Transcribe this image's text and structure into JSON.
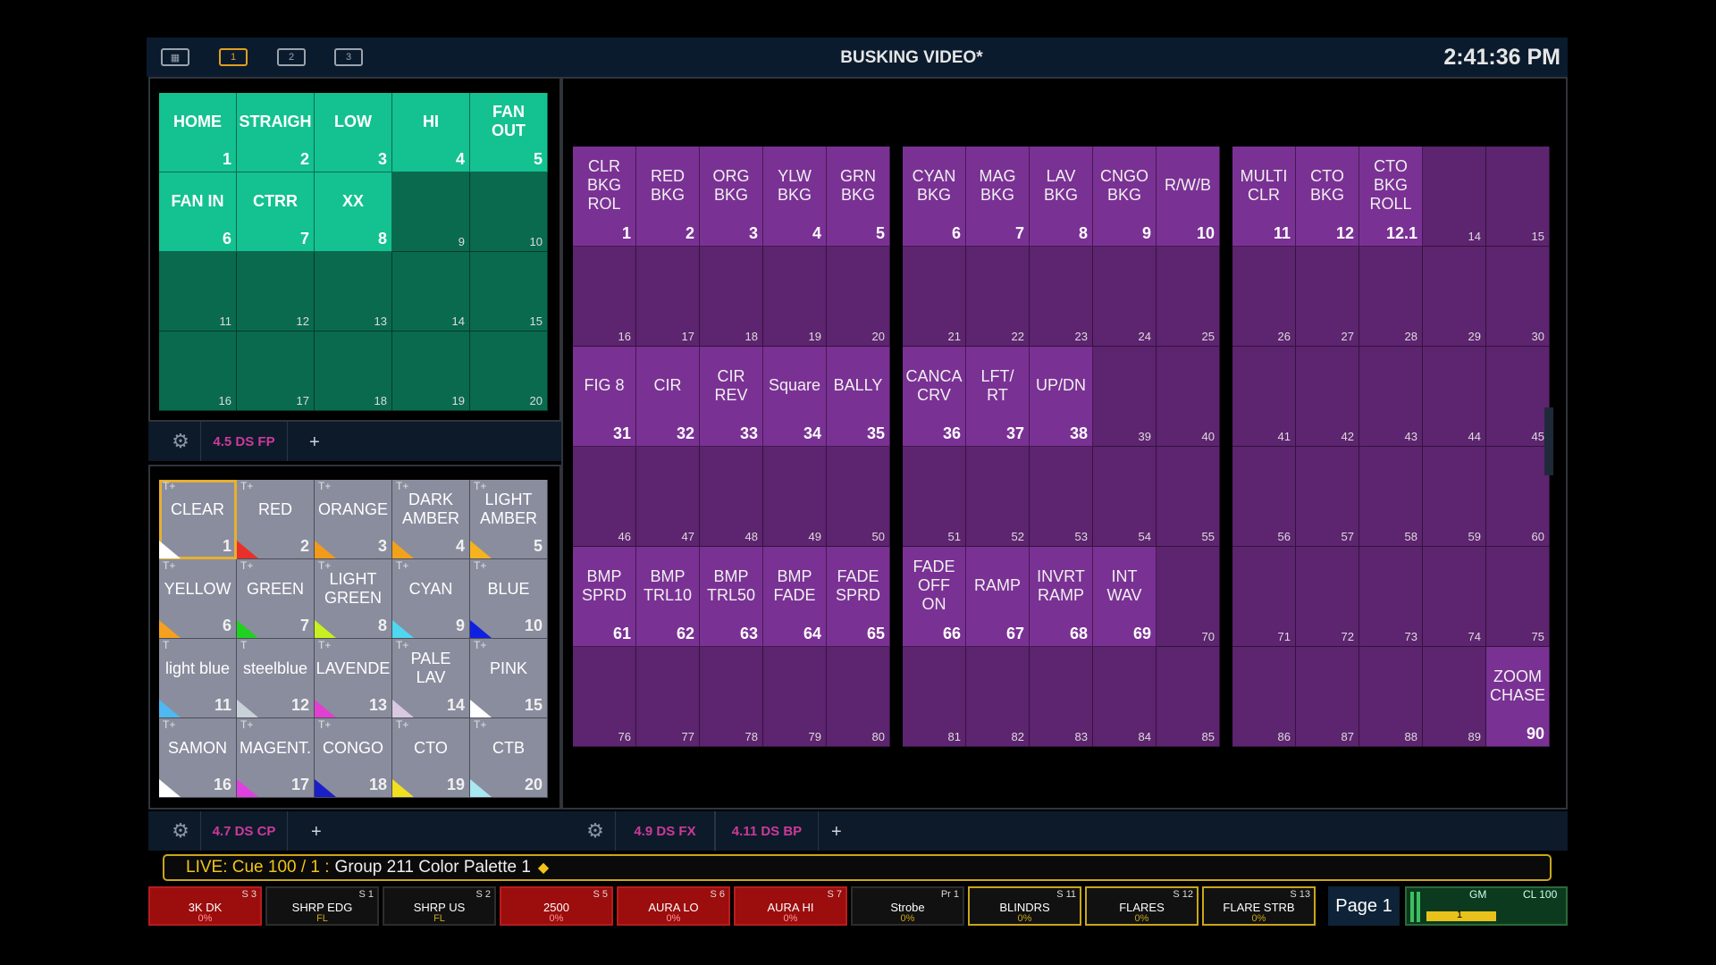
{
  "topbar": {
    "title": "BUSKING VIDEO*",
    "clock": "2:41:36 PM",
    "workspace_tabs": [
      "1",
      "2",
      "3"
    ],
    "active_workspace": "1"
  },
  "focus_palettes": {
    "tab_label": "4.5 DS FP",
    "tiles": [
      {
        "label": "HOME",
        "num": "1"
      },
      {
        "label": "STRAIGH",
        "num": "2"
      },
      {
        "label": "LOW",
        "num": "3"
      },
      {
        "label": "HI",
        "num": "4"
      },
      {
        "label": "FAN\nOUT",
        "num": "5"
      },
      {
        "label": "FAN IN",
        "num": "6"
      },
      {
        "label": "CTRR",
        "num": "7"
      },
      {
        "label": "XX",
        "num": "8"
      },
      {
        "label": "",
        "num": "9"
      },
      {
        "label": "",
        "num": "10"
      },
      {
        "label": "",
        "num": "11"
      },
      {
        "label": "",
        "num": "12"
      },
      {
        "label": "",
        "num": "13"
      },
      {
        "label": "",
        "num": "14"
      },
      {
        "label": "",
        "num": "15"
      },
      {
        "label": "",
        "num": "16"
      },
      {
        "label": "",
        "num": "17"
      },
      {
        "label": "",
        "num": "18"
      },
      {
        "label": "",
        "num": "19"
      },
      {
        "label": "",
        "num": "20"
      }
    ]
  },
  "color_palettes": {
    "tab_label": "4.7 DS CP",
    "tiles": [
      {
        "label": "CLEAR",
        "num": "1",
        "tag": "T+",
        "swatch": "#ffffff"
      },
      {
        "label": "RED",
        "num": "2",
        "tag": "T+",
        "swatch": "#e8302a"
      },
      {
        "label": "ORANGE",
        "num": "3",
        "tag": "T+",
        "swatch": "#f29a1a"
      },
      {
        "label": "DARK\nAMBER",
        "num": "4",
        "tag": "T+",
        "swatch": "#f2a21a"
      },
      {
        "label": "LIGHT\nAMBER",
        "num": "5",
        "tag": "T+",
        "swatch": "#f5b31e"
      },
      {
        "label": "YELLOW",
        "num": "6",
        "tag": "T+",
        "swatch": "#f5a020"
      },
      {
        "label": "GREEN",
        "num": "7",
        "tag": "T+",
        "swatch": "#1fd21f"
      },
      {
        "label": "LIGHT\nGREEN",
        "num": "8",
        "tag": "T+",
        "swatch": "#c8f020"
      },
      {
        "label": "CYAN",
        "num": "9",
        "tag": "T+",
        "swatch": "#4fd8f0"
      },
      {
        "label": "BLUE",
        "num": "10",
        "tag": "T+",
        "swatch": "#1020e0"
      },
      {
        "label": "light blue",
        "num": "11",
        "tag": "T",
        "swatch": "#4fb8f0"
      },
      {
        "label": "steelblue",
        "num": "12",
        "tag": "T",
        "swatch": "#c8d0d8"
      },
      {
        "label": "LAVENDE",
        "num": "13",
        "tag": "T+",
        "swatch": "#e040d0"
      },
      {
        "label": "PALE\nLAV",
        "num": "14",
        "tag": "T+",
        "swatch": "#d8c8e0"
      },
      {
        "label": "PINK",
        "num": "15",
        "tag": "T+",
        "swatch": "#ffffff"
      },
      {
        "label": "SAMON",
        "num": "16",
        "tag": "T+",
        "swatch": "#ffffff"
      },
      {
        "label": "MAGENT.",
        "num": "17",
        "tag": "T+",
        "swatch": "#e040e0"
      },
      {
        "label": "CONGO",
        "num": "18",
        "tag": "T+",
        "swatch": "#1a20c8"
      },
      {
        "label": "CTO",
        "num": "19",
        "tag": "T+",
        "swatch": "#f0e020"
      },
      {
        "label": "CTB",
        "num": "20",
        "tag": "T+",
        "swatch": "#a8e8f0"
      }
    ],
    "selected_index": 0
  },
  "effects": {
    "tab_labels": [
      "4.9 DS FX",
      "4.11 DS BP"
    ],
    "tiles": [
      {
        "label": "CLR\nBKG\nROL",
        "num": "1"
      },
      {
        "label": "RED\nBKG",
        "num": "2"
      },
      {
        "label": "ORG\nBKG",
        "num": "3"
      },
      {
        "label": "YLW\nBKG",
        "num": "4"
      },
      {
        "label": "GRN\nBKG",
        "num": "5"
      },
      {
        "label": "CYAN\nBKG",
        "num": "6"
      },
      {
        "label": "MAG\nBKG",
        "num": "7"
      },
      {
        "label": "LAV\nBKG",
        "num": "8"
      },
      {
        "label": "CNGO\nBKG",
        "num": "9"
      },
      {
        "label": "R/W/B",
        "num": "10"
      },
      {
        "label": "MULTI\nCLR",
        "num": "11"
      },
      {
        "label": "CTO\nBKG",
        "num": "12"
      },
      {
        "label": "CTO\nBKG\nROLL",
        "num": "12.1"
      },
      {
        "label": "",
        "num": "14"
      },
      {
        "label": "",
        "num": "15"
      },
      {
        "label": "",
        "num": "16"
      },
      {
        "label": "",
        "num": "17"
      },
      {
        "label": "",
        "num": "18"
      },
      {
        "label": "",
        "num": "19"
      },
      {
        "label": "",
        "num": "20"
      },
      {
        "label": "",
        "num": "21"
      },
      {
        "label": "",
        "num": "22"
      },
      {
        "label": "",
        "num": "23"
      },
      {
        "label": "",
        "num": "24"
      },
      {
        "label": "",
        "num": "25"
      },
      {
        "label": "",
        "num": "26"
      },
      {
        "label": "",
        "num": "27"
      },
      {
        "label": "",
        "num": "28"
      },
      {
        "label": "",
        "num": "29"
      },
      {
        "label": "",
        "num": "30"
      },
      {
        "label": "FIG 8",
        "num": "31"
      },
      {
        "label": "CIR",
        "num": "32"
      },
      {
        "label": "CIR\nREV",
        "num": "33"
      },
      {
        "label": "Square",
        "num": "34"
      },
      {
        "label": "BALLY",
        "num": "35"
      },
      {
        "label": "CANCA\nCRV",
        "num": "36"
      },
      {
        "label": "LFT/\nRT",
        "num": "37"
      },
      {
        "label": "UP/DN",
        "num": "38"
      },
      {
        "label": "",
        "num": "39"
      },
      {
        "label": "",
        "num": "40"
      },
      {
        "label": "",
        "num": "41"
      },
      {
        "label": "",
        "num": "42"
      },
      {
        "label": "",
        "num": "43"
      },
      {
        "label": "",
        "num": "44"
      },
      {
        "label": "",
        "num": "45"
      },
      {
        "label": "",
        "num": "46"
      },
      {
        "label": "",
        "num": "47"
      },
      {
        "label": "",
        "num": "48"
      },
      {
        "label": "",
        "num": "49"
      },
      {
        "label": "",
        "num": "50"
      },
      {
        "label": "",
        "num": "51"
      },
      {
        "label": "",
        "num": "52"
      },
      {
        "label": "",
        "num": "53"
      },
      {
        "label": "",
        "num": "54"
      },
      {
        "label": "",
        "num": "55"
      },
      {
        "label": "",
        "num": "56"
      },
      {
        "label": "",
        "num": "57"
      },
      {
        "label": "",
        "num": "58"
      },
      {
        "label": "",
        "num": "59"
      },
      {
        "label": "",
        "num": "60"
      },
      {
        "label": "BMP\nSPRD",
        "num": "61"
      },
      {
        "label": "BMP\nTRL10",
        "num": "62"
      },
      {
        "label": "BMP\nTRL50",
        "num": "63"
      },
      {
        "label": "BMP\nFADE",
        "num": "64"
      },
      {
        "label": "FADE\nSPRD",
        "num": "65"
      },
      {
        "label": "FADE\nOFF\nON",
        "num": "66"
      },
      {
        "label": "RAMP",
        "num": "67"
      },
      {
        "label": "INVRT\nRAMP",
        "num": "68"
      },
      {
        "label": "INT\nWAV",
        "num": "69"
      },
      {
        "label": "",
        "num": "70"
      },
      {
        "label": "",
        "num": "71"
      },
      {
        "label": "",
        "num": "72"
      },
      {
        "label": "",
        "num": "73"
      },
      {
        "label": "",
        "num": "74"
      },
      {
        "label": "",
        "num": "75"
      },
      {
        "label": "",
        "num": "76"
      },
      {
        "label": "",
        "num": "77"
      },
      {
        "label": "",
        "num": "78"
      },
      {
        "label": "",
        "num": "79"
      },
      {
        "label": "",
        "num": "80"
      },
      {
        "label": "",
        "num": "81"
      },
      {
        "label": "",
        "num": "82"
      },
      {
        "label": "",
        "num": "83"
      },
      {
        "label": "",
        "num": "84"
      },
      {
        "label": "",
        "num": "85"
      },
      {
        "label": "",
        "num": "86"
      },
      {
        "label": "",
        "num": "87"
      },
      {
        "label": "",
        "num": "88"
      },
      {
        "label": "",
        "num": "89"
      },
      {
        "label": "ZOOM\nCHASE",
        "num": "90"
      }
    ]
  },
  "command_line": {
    "live": "LIVE: Cue  100 / 1 :",
    "text": "Group 211 Color Palette 1",
    "marker": "◆"
  },
  "faders": [
    {
      "name": "3K DK",
      "value": "0%",
      "slot": "S 3",
      "style": "red"
    },
    {
      "name": "SHRP EDG",
      "value": "FL",
      "slot": "S 1",
      "style": "dark"
    },
    {
      "name": "SHRP US",
      "value": "FL",
      "slot": "S 2",
      "style": "dark"
    },
    {
      "name": "2500",
      "value": "0%",
      "slot": "S 5",
      "style": "red"
    },
    {
      "name": "AURA LO",
      "value": "0%",
      "slot": "S 6",
      "style": "red"
    },
    {
      "name": "AURA HI",
      "value": "0%",
      "slot": "S 7",
      "style": "red"
    },
    {
      "name": "Strobe",
      "value": "0%",
      "slot": "Pr 1",
      "style": "dark"
    },
    {
      "name": "BLINDRS",
      "value": "0%",
      "slot": "S 11",
      "style": "yel"
    },
    {
      "name": "FLARES",
      "value": "0%",
      "slot": "S 12",
      "style": "yel"
    },
    {
      "name": "FLARE STRB",
      "value": "0%",
      "slot": "S 13",
      "style": "yel"
    }
  ],
  "page_button": "Page 1",
  "grandmaster": {
    "label": "GM",
    "cue_list": "CL 100",
    "level": "1"
  },
  "colors": {
    "fp_on": "#14c191",
    "fp_off": "#0a6a4e",
    "fx_on": "#7a3194",
    "fx_off": "#5d246f",
    "cp_tile": "#8a8d9e",
    "accent_yellow": "#c9a61a",
    "tab_magenta": "#cc3a9a"
  }
}
